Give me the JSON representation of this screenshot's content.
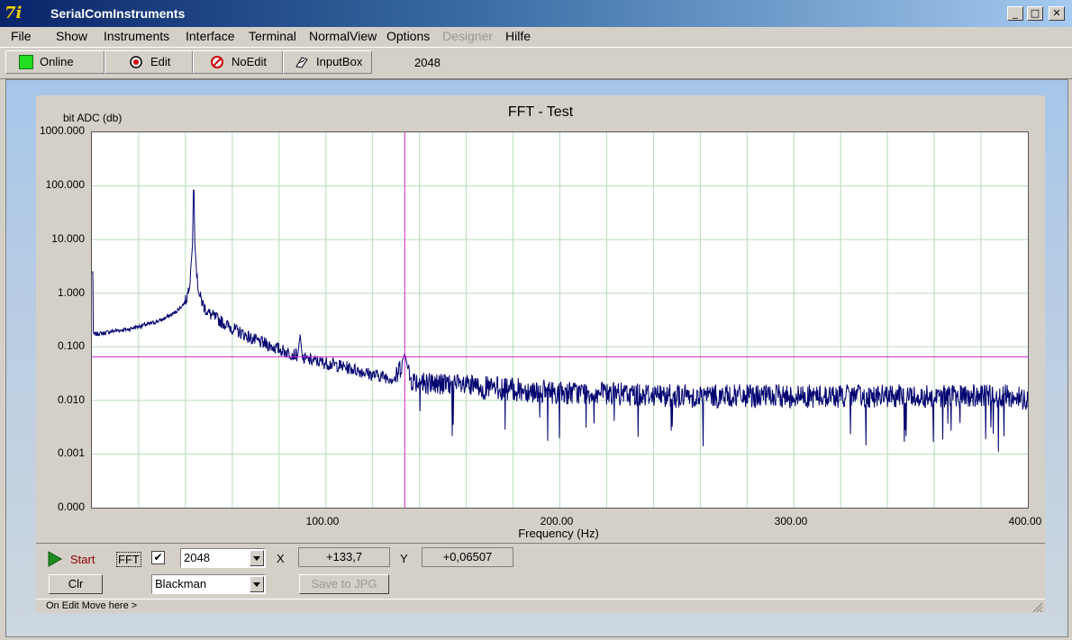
{
  "window": {
    "title": "SerialComInstruments"
  },
  "menu": [
    "File",
    "Show",
    "Instruments",
    "Interface",
    "Terminal",
    "NormalView",
    "Options",
    "Designer",
    "Hilfe"
  ],
  "toolbar": {
    "online": "Online",
    "edit": "Edit",
    "noedit": "NoEdit",
    "inputbox": "InputBox",
    "count": "2048"
  },
  "colors": {
    "online": "#22dd22",
    "trace": "#000070",
    "cursor": "#d020d0",
    "grid": "#b6dcb6"
  },
  "chart_data": {
    "type": "line",
    "title": "FFT - Test",
    "ylabel": "bit ADC (db)",
    "xlabel": "Frequency (Hz)",
    "y_scale": "log",
    "xlim": [
      0,
      400
    ],
    "ylim": [
      0.001,
      1000
    ],
    "y_ticks": [
      "1000.000",
      "100.000",
      "10.000",
      "1.000",
      "0.100",
      "0.010",
      "0.001",
      "0.000"
    ],
    "x_ticks": [
      "100.00",
      "200.00",
      "300.00",
      "400.00"
    ],
    "peaks": [
      {
        "x": 43.5,
        "y": 150
      },
      {
        "x": 89,
        "y": 0.17
      },
      {
        "x": 133.7,
        "y": 0.075
      }
    ],
    "series": [
      {
        "x": [
          0,
          5,
          10,
          15,
          20,
          25,
          30,
          35,
          38,
          40,
          41,
          42,
          43,
          43.5,
          44,
          45,
          46,
          48,
          50,
          55,
          60,
          65,
          70,
          75,
          80,
          85,
          88,
          89,
          90,
          95,
          100,
          105,
          110,
          115,
          120,
          125,
          130,
          133.7,
          136,
          140,
          150,
          160,
          170,
          180,
          190,
          200,
          210,
          220,
          230,
          240,
          250,
          260,
          270,
          280,
          290,
          300,
          310,
          320,
          330,
          340,
          350,
          360,
          370,
          380,
          390,
          400
        ],
        "y": [
          0.17,
          0.18,
          0.2,
          0.21,
          0.24,
          0.27,
          0.32,
          0.42,
          0.55,
          0.7,
          1.0,
          2.0,
          8.0,
          150,
          8.0,
          1.8,
          0.9,
          0.55,
          0.42,
          0.3,
          0.22,
          0.17,
          0.13,
          0.11,
          0.09,
          0.075,
          0.07,
          0.17,
          0.06,
          0.055,
          0.05,
          0.045,
          0.04,
          0.035,
          0.03,
          0.028,
          0.025,
          0.075,
          0.025,
          0.022,
          0.02,
          0.018,
          0.017,
          0.016,
          0.015,
          0.014,
          0.014,
          0.013,
          0.013,
          0.013,
          0.012,
          0.012,
          0.012,
          0.012,
          0.012,
          0.012,
          0.012,
          0.012,
          0.012,
          0.012,
          0.012,
          0.012,
          0.012,
          0.012,
          0.012,
          0.011
        ]
      }
    ],
    "cursor": {
      "x": 133.7,
      "y": 0.06507
    },
    "grid": true
  },
  "controls": {
    "start": "Start",
    "fft": "FFT",
    "fft_checked": "✔",
    "points": "2048",
    "x_label": "X",
    "x_value": "+133,7",
    "y_label": "Y",
    "y_value": "+0,06507",
    "clr": "Clr",
    "window_fn": "Blackman",
    "save": "Save to JPG"
  },
  "status": {
    "hint": "On Edit Move here >"
  }
}
